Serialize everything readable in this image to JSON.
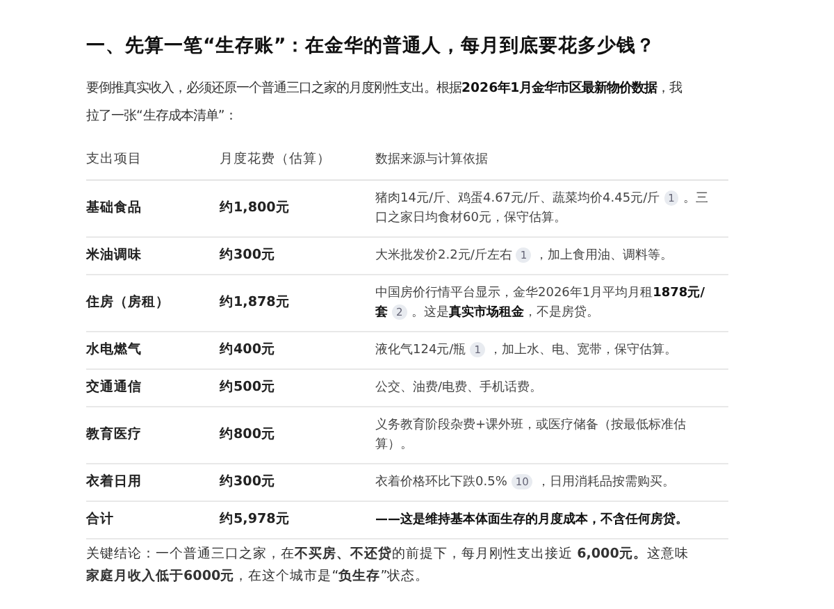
{
  "heading": "一、先算一笔“生存账”：在金华的普通人，每月到底要花多少钱？",
  "intro": [
    "要倒推真实收入，必须还原一个普通三口之家的月度刚性支出。根据**2026年1月金华市区最新物价数据**，我",
    "拉了一张“生存成本清单”："
  ],
  "table": {
    "columns": [
      "支出项目",
      "月度花费（估算）",
      "数据来源与计算依据"
    ],
    "rows": [
      {
        "item": "基础食品",
        "cost": "约1,800元",
        "basis": [
          [
            {
              "kind": "text",
              "text": "猪肉14元/斤、鸡蛋4.67元/斤、蔬菜均价4.45元/斤"
            },
            {
              "kind": "ref",
              "text": "1"
            },
            {
              "kind": "text",
              "text": "。三"
            }
          ],
          [
            {
              "kind": "text",
              "text": "口之家日均食材60元，保守估算。"
            }
          ]
        ]
      },
      {
        "item": "米油调味",
        "cost": "约300元",
        "basis": [
          [
            {
              "kind": "text",
              "text": "大米批发价2.2元/斤左右"
            },
            {
              "kind": "ref",
              "text": "1"
            },
            {
              "kind": "text",
              "text": "，加上食用油、调料等。"
            }
          ]
        ]
      },
      {
        "item": "住房（房租）",
        "cost": "约1,878元",
        "basis": [
          [
            {
              "kind": "text",
              "text": "中国房价行情平台显示，金华2026年1月平均月租**1878元/**"
            }
          ],
          [
            {
              "kind": "text",
              "text": "**套**"
            },
            {
              "kind": "ref",
              "text": "2"
            },
            {
              "kind": "text",
              "text": "。这是**真实市场租金**，不是房贷。"
            }
          ]
        ]
      },
      {
        "item": "水电燃气",
        "cost": "约400元",
        "basis": [
          [
            {
              "kind": "text",
              "text": "液化气124元/瓶"
            },
            {
              "kind": "ref",
              "text": "1"
            },
            {
              "kind": "text",
              "text": "，加上水、电、宽带，保守估算。"
            }
          ]
        ]
      },
      {
        "item": "交通通信",
        "cost": "约500元",
        "basis": [
          [
            {
              "kind": "text",
              "text": "公交、油费/电费、手机话费。"
            }
          ]
        ]
      },
      {
        "item": "教育医疗",
        "cost": "约800元",
        "basis": [
          [
            {
              "kind": "text",
              "text": "义务教育阶段杂费+课外班，或医疗储备（按最低标准估"
            }
          ],
          [
            {
              "kind": "text",
              "text": "算）。"
            }
          ]
        ]
      },
      {
        "item": "衣着日用",
        "cost": "约300元",
        "basis": [
          [
            {
              "kind": "text",
              "text": "衣着价格环比下跌0.5%"
            },
            {
              "kind": "ref",
              "text": "10"
            },
            {
              "kind": "text",
              "text": "，日用消耗品按需购买。"
            }
          ]
        ]
      },
      {
        "item": "合计",
        "cost": "约5,978元",
        "basis": [
          [
            {
              "kind": "text",
              "text": "**——这是维持基本体面生存的月度成本，不含任何房贷。**"
            }
          ]
        ]
      }
    ]
  },
  "conclusion": [
    "关键结论：一个普通三口之家，在**不买房、不还贷**的前提下，每月刚性支出接近 **6,000元。**这意味",
    "**家庭月收入低于6000元**，在这个城市是“**负生存**”状态。"
  ]
}
